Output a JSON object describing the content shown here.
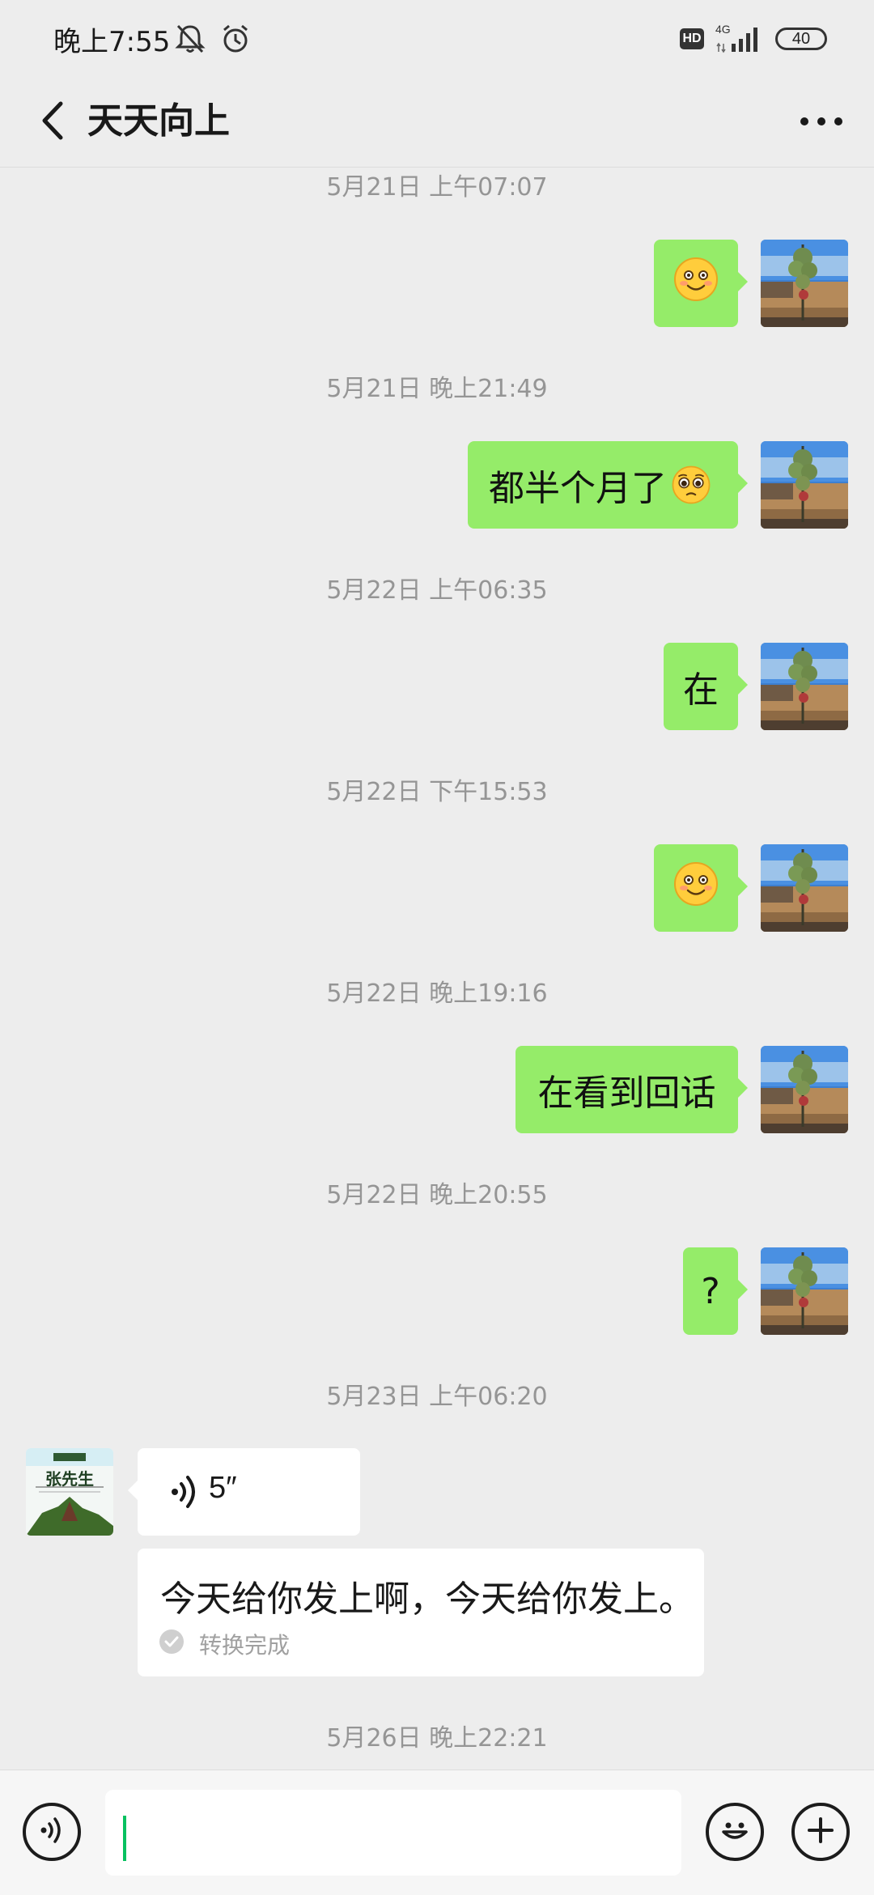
{
  "status_bar": {
    "time": "晚上7:55",
    "network": "4G",
    "hd_label": "HD",
    "battery": "40"
  },
  "header": {
    "title": "天天向上",
    "back_icon": "chevron-left-icon",
    "more_icon": "more-dots-icon"
  },
  "messages": [
    {
      "type": "timestamp",
      "text": "5月21日 上午07:07"
    },
    {
      "type": "sent",
      "kind": "emoji",
      "emoji": "smile-emoji"
    },
    {
      "type": "timestamp",
      "text": "5月21日 晚上21:49"
    },
    {
      "type": "sent",
      "kind": "text",
      "text": "都半个月了",
      "emoji": "pleading-emoji"
    },
    {
      "type": "timestamp",
      "text": "5月22日 上午06:35"
    },
    {
      "type": "sent",
      "kind": "text",
      "text": "在"
    },
    {
      "type": "timestamp",
      "text": "5月22日 下午15:53"
    },
    {
      "type": "sent",
      "kind": "emoji",
      "emoji": "smile-emoji"
    },
    {
      "type": "timestamp",
      "text": "5月22日 晚上19:16"
    },
    {
      "type": "sent",
      "kind": "text",
      "text": "在看到回话"
    },
    {
      "type": "timestamp",
      "text": "5月22日 晚上20:55"
    },
    {
      "type": "sent",
      "kind": "text",
      "text": "?"
    },
    {
      "type": "timestamp",
      "text": "5月23日 上午06:20"
    },
    {
      "type": "received",
      "kind": "voice",
      "duration": "5″"
    },
    {
      "type": "received",
      "kind": "transcript",
      "text": "今天给你发上啊，今天给你发上。",
      "status": "转换完成"
    },
    {
      "type": "timestamp",
      "text": "5月26日 晚上22:21"
    }
  ],
  "contact_avatar_text": "张先生",
  "input": {
    "value": "",
    "voice_icon": "voice-mode-icon",
    "emoji_icon": "emoji-icon",
    "plus_icon": "plus-icon"
  },
  "colors": {
    "sent_bubble": "#95ec69",
    "received_bubble": "#ffffff",
    "background": "#ededed",
    "caret": "#07c160"
  }
}
